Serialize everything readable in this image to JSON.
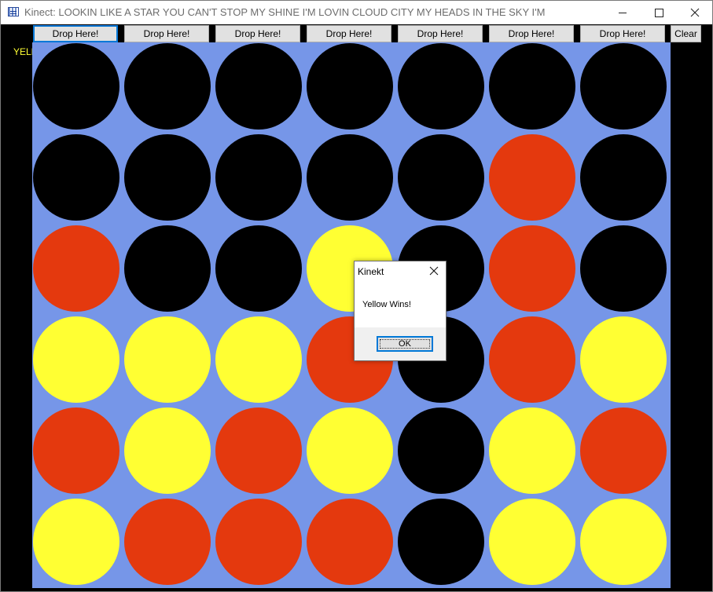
{
  "window": {
    "title": "Kinect: LOOKIN LIKE A STAR YOU CAN'T STOP MY SHINE I'M LOVIN CLOUD CITY MY HEADS IN THE SKY I'M",
    "icon": "app-grid-icon"
  },
  "toolbar": {
    "drop_buttons": [
      "Drop Here!",
      "Drop Here!",
      "Drop Here!",
      "Drop Here!",
      "Drop Here!",
      "Drop Here!",
      "Drop Here!"
    ],
    "clear_label": "Clear"
  },
  "status": {
    "turn": "YELLOW"
  },
  "colors": {
    "board": "#7696e8",
    "empty": "#000000",
    "red": "#e4390e",
    "yellow": "#ffff33"
  },
  "board": {
    "rows": 6,
    "cols": 7,
    "cells": [
      [
        "empty",
        "empty",
        "empty",
        "empty",
        "empty",
        "empty",
        "empty"
      ],
      [
        "empty",
        "empty",
        "empty",
        "empty",
        "empty",
        "red",
        "empty"
      ],
      [
        "red",
        "empty",
        "empty",
        "yellow",
        "empty",
        "red",
        "empty"
      ],
      [
        "yellow",
        "yellow",
        "yellow",
        "red",
        "empty",
        "red",
        "yellow"
      ],
      [
        "red",
        "yellow",
        "red",
        "yellow",
        "empty",
        "yellow",
        "red"
      ],
      [
        "yellow",
        "red",
        "red",
        "red",
        "empty",
        "yellow",
        "yellow"
      ]
    ]
  },
  "dialog": {
    "title": "Kinekt",
    "message": "Yellow Wins!",
    "ok_label": "OK"
  }
}
